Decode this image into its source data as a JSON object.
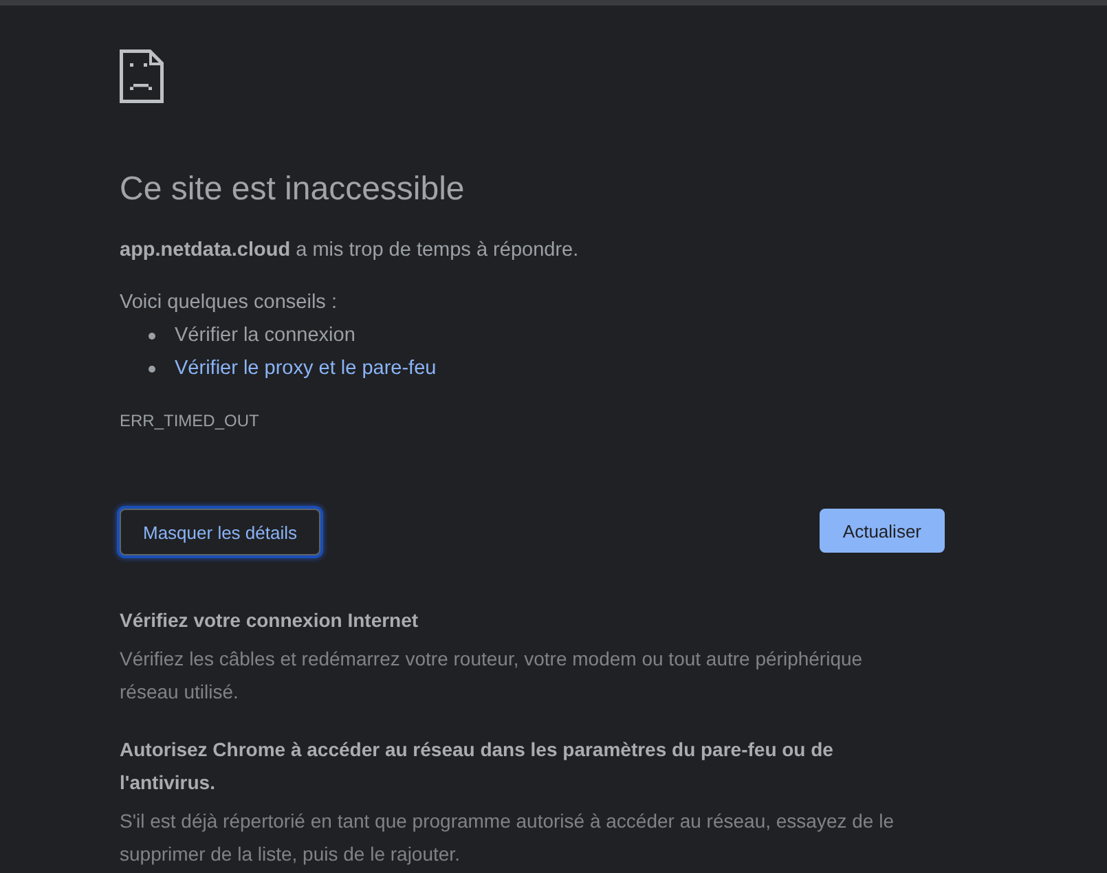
{
  "error_page": {
    "title": "Ce site est inaccessible",
    "message": "**app.netdata.cloud** a mis trop de temps à répondre.",
    "suggestions_intro": "Voici quelques conseils :",
    "suggestions": [
      {
        "text": "Vérifier la connexion",
        "kind": "text"
      },
      {
        "text": "Vérifier le proxy et le pare-feu",
        "kind": "link"
      }
    ],
    "error_code": "ERR_TIMED_OUT"
  },
  "buttons": [
    {
      "label": "Masquer les détails",
      "kind": "secondary",
      "focused": true
    },
    {
      "label": "Actualiser",
      "kind": "primary",
      "focused": false
    }
  ],
  "details": [
    {
      "heading": "Vérifiez votre connexion Internet",
      "body": "Vérifiez les câbles et redémarrez votre routeur, votre modem ou tout autre périphérique réseau utilisé."
    },
    {
      "heading": "Autorisez Chrome à accéder au réseau dans les paramètres du pare-feu ou de l'antivirus.",
      "body": "S'il est déjà répertorié en tant que programme autorisé à accéder au réseau, essayez de le supprimer de la liste, puis de le rajouter."
    }
  ]
}
